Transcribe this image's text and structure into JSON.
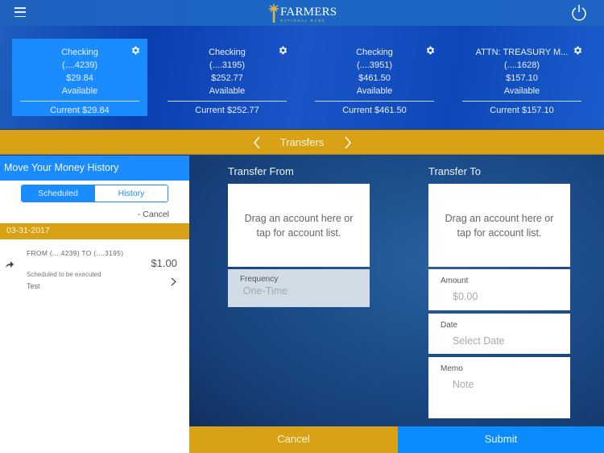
{
  "header": {
    "brand_name": "FARMERS",
    "brand_sub": "NATIONAL BANK",
    "menu_icon": "hamburger-menu-icon",
    "power_icon": "power-icon"
  },
  "accounts": [
    {
      "name": "Checking",
      "number": "(....4239)",
      "available_amount": "$29.84",
      "available_label": "Available",
      "current": "Current $29.84",
      "selected": true
    },
    {
      "name": "Checking",
      "number": "(....3195)",
      "available_amount": "$252.77",
      "available_label": "Available",
      "current": "Current $252.77",
      "selected": false
    },
    {
      "name": "Checking",
      "number": "(....3951)",
      "available_amount": "$461.50",
      "available_label": "Available",
      "current": "Current $461.50",
      "selected": false
    },
    {
      "name": "ATTN: TREASURY M...",
      "number": "(....1628)",
      "available_amount": "$157.10",
      "available_label": "Available",
      "current": "Current $157.10",
      "selected": false
    }
  ],
  "nav": {
    "title": "Transfers",
    "prev_icon": "chevron-left-icon",
    "next_icon": "chevron-right-icon"
  },
  "history": {
    "title": "Move Your Money History",
    "tabs": [
      "Scheduled",
      "History"
    ],
    "active_tab": "Scheduled",
    "cancel_label": "- Cancel",
    "groups": [
      {
        "date": "03-31-2017",
        "items": [
          {
            "from_to": "FROM  (....4239)  TO  (....3195)",
            "amount": "$1.00",
            "status": "Scheduled to be executed",
            "memo": "Test"
          }
        ]
      }
    ]
  },
  "transfer": {
    "from_title": "Transfer From",
    "to_title": "Transfer To",
    "drop_hint_line1": "Drag an account here or",
    "drop_hint_line2": "tap for account list.",
    "frequency": {
      "label": "Frequency",
      "value": "One-Time"
    },
    "amount": {
      "label": "Amount",
      "placeholder": "$0.00"
    },
    "date": {
      "label": "Date",
      "placeholder": "Select Date"
    },
    "memo": {
      "label": "Memo",
      "placeholder": "Note"
    }
  },
  "actions": {
    "cancel_label": "Cancel",
    "submit_label": "Submit"
  },
  "colors": {
    "gold": "#d8a116",
    "accent_blue": "#1a8cff",
    "header_blue": "#1c66c4"
  }
}
